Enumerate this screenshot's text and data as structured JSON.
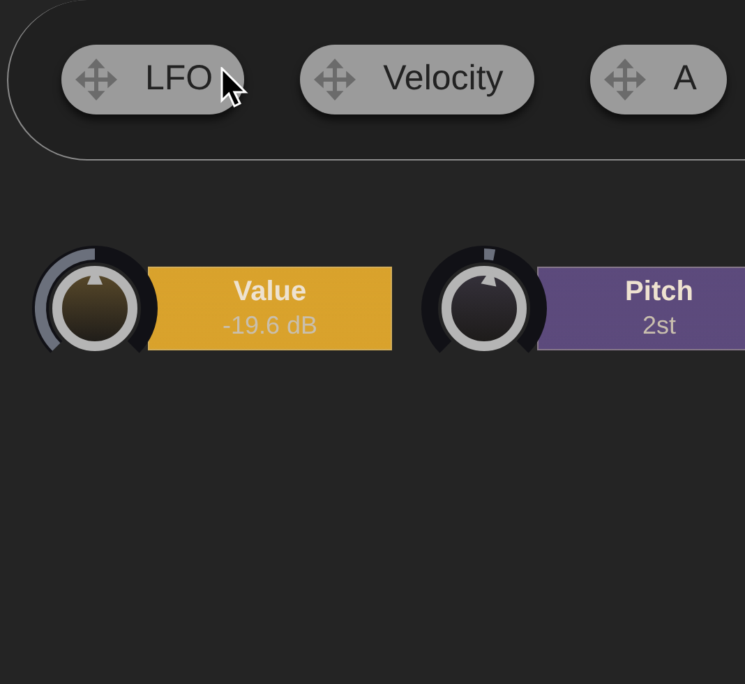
{
  "modulators": [
    {
      "label": "LFO"
    },
    {
      "label": "Velocity"
    },
    {
      "label": "A"
    }
  ],
  "knobs": [
    {
      "name": "Value",
      "reading": "-19.6 dB",
      "kind": "unipolar",
      "level": 0.5,
      "color": "#d9a22c"
    },
    {
      "name": "Pitch",
      "reading": "2st",
      "kind": "bipolar",
      "level": 0.54,
      "color": "#5c4a7c"
    }
  ]
}
